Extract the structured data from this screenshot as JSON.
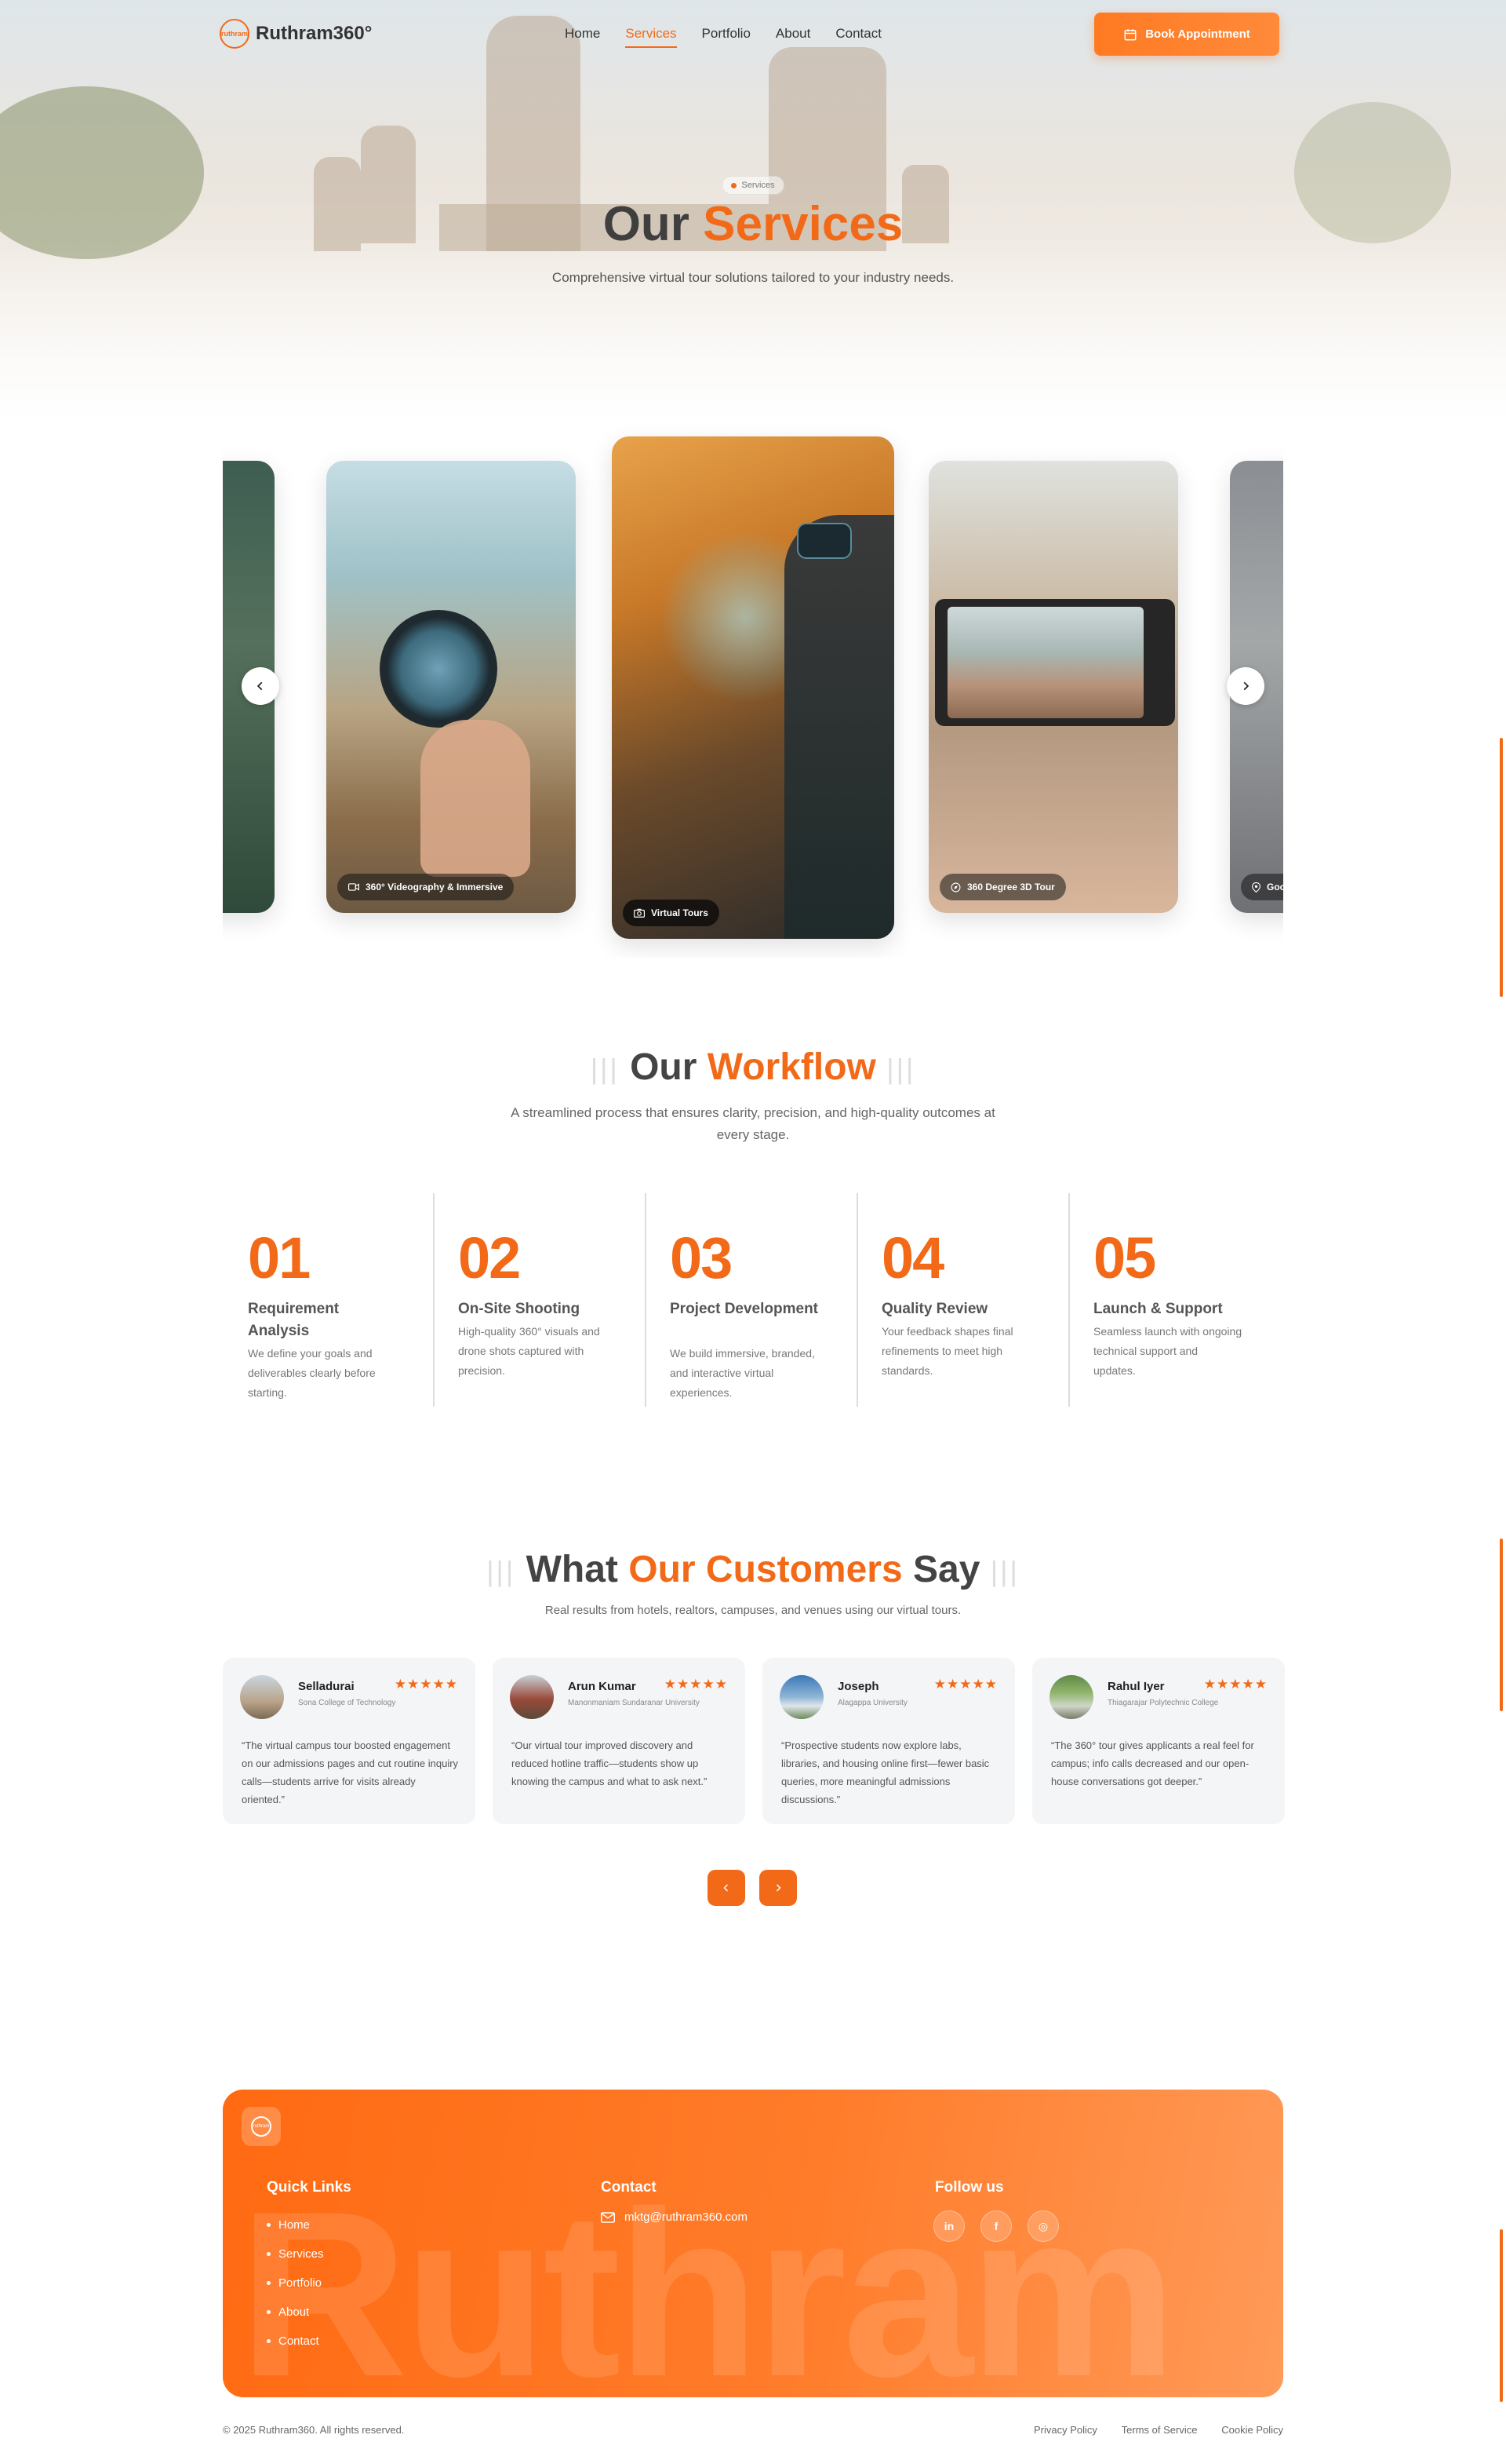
{
  "header": {
    "logo_text": "Ruthram360°",
    "logo_mark": "ruthram",
    "nav": [
      {
        "label": "Home",
        "active": false
      },
      {
        "label": "Services",
        "active": true
      },
      {
        "label": "Portfolio",
        "active": false
      },
      {
        "label": "About",
        "active": false
      },
      {
        "label": "Contact",
        "active": false
      }
    ],
    "cta_label": "Book Appointment",
    "cta_icon": "calendar-icon"
  },
  "hero": {
    "badge": "Services",
    "title_dark": "Our",
    "title_accent": "Services",
    "subtitle": "Comprehensive virtual tour solutions tailored to your industry needs."
  },
  "carousel": {
    "slides": [
      {
        "label": "",
        "icon": "",
        "state": "partial-left"
      },
      {
        "label": "360° Videography & Immersive",
        "icon": "video-icon",
        "state": "side"
      },
      {
        "label": "Virtual Tours",
        "icon": "camera-icon",
        "state": "active"
      },
      {
        "label": "360 Degree 3D Tour",
        "icon": "compass-icon",
        "state": "side"
      },
      {
        "label": "Goo",
        "icon": "map-pin-icon",
        "state": "partial-right"
      }
    ],
    "prev_icon": "chevron-left-icon",
    "next_icon": "chevron-right-icon"
  },
  "workflow": {
    "title_dark": "Our",
    "title_accent": "Workflow",
    "subtitle_line1": "A streamlined process that ensures clarity, precision, and high-quality outcomes at",
    "subtitle_line2": "every stage.",
    "steps": [
      {
        "num": "01",
        "name": "Requirement Analysis",
        "desc": "We define your goals and deliverables clearly before starting."
      },
      {
        "num": "02",
        "name": "On-Site Shooting",
        "desc": "High-quality 360° visuals and drone shots captured with precision."
      },
      {
        "num": "03",
        "name": "Project Development",
        "desc": "We build immersive, branded, and interactive virtual experiences."
      },
      {
        "num": "04",
        "name": "Quality Review",
        "desc": "Your feedback shapes final refinements to meet high standards."
      },
      {
        "num": "05",
        "name": "Launch & Support",
        "desc": "Seamless launch with ongoing technical support and updates."
      }
    ]
  },
  "testimonials": {
    "title_part1": "What",
    "title_accent": "Our Customers",
    "title_part2": "Say",
    "subtitle": "Real results from hotels, realtors, campuses, and venues using our virtual tours.",
    "items": [
      {
        "name": "Selladurai",
        "org": "Sona College of Technology",
        "rating": 5,
        "quote": "“The virtual campus tour boosted engagement on our admissions pages and cut routine inquiry calls—students arrive for visits already oriented.”"
      },
      {
        "name": "Arun Kumar",
        "org": "Manonmaniam Sundaranar University",
        "rating": 5,
        "quote": "“Our virtual tour improved discovery and reduced hotline traffic—students show up knowing the campus and what to ask next.”"
      },
      {
        "name": "Joseph",
        "org": "Alagappa University",
        "rating": 5,
        "quote": "“Prospective students now explore labs, libraries, and housing online first—fewer basic queries, more meaningful admissions discussions.”"
      },
      {
        "name": "Rahul Iyer",
        "org": "Thiagarajar Polytechnic College",
        "rating": 5,
        "quote": "“The 360° tour gives applicants a real feel for campus; info calls decreased and our open-house conversations got deeper.”"
      }
    ],
    "stars": "★★★★★",
    "prev_icon": "chevron-left-icon",
    "next_icon": "chevron-right-icon"
  },
  "footer": {
    "watermark": "Ruthram",
    "logo_mark": "ruthram",
    "quick_links_title": "Quick Links",
    "quick_links": [
      "Home",
      "Services",
      "Portfolio",
      "About",
      "Contact"
    ],
    "contact_title": "Contact",
    "email": "mktg@ruthram360.com",
    "email_icon": "mail-icon",
    "follow_title": "Follow us",
    "socials": [
      {
        "icon": "linkedin-icon",
        "glyph": "in"
      },
      {
        "icon": "facebook-icon",
        "glyph": "f"
      },
      {
        "icon": "instagram-icon",
        "glyph": "◎"
      }
    ],
    "copyright": "© 2025 Ruthram360. All rights reserved.",
    "legal": [
      "Privacy Policy",
      "Terms of Service",
      "Cookie Policy"
    ]
  },
  "colors": {
    "accent": "#f26a18",
    "heading": "#444444",
    "card_bg": "#f4f5f7"
  }
}
